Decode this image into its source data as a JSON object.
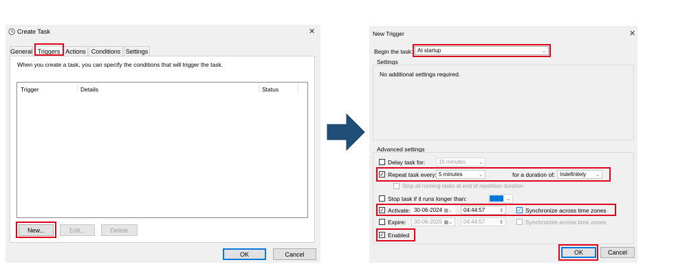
{
  "create_task": {
    "title": "Create Task",
    "tabs": [
      "General",
      "Triggers",
      "Actions",
      "Conditions",
      "Settings"
    ],
    "description": "When you create a task, you can specify the conditions that will trigger the task.",
    "columns": [
      "Trigger",
      "Details",
      "Status"
    ],
    "new_label": "New...",
    "edit_label": "Edit...",
    "delete_label": "Delete",
    "ok_label": "OK",
    "cancel_label": "Cancel",
    "close_glyph": "✕"
  },
  "new_trigger": {
    "title": "New Trigger",
    "close_glyph": "✕",
    "begin_label": "Begin the task:",
    "begin_value": "At startup",
    "settings_label": "Settings",
    "settings_text": "No additional settings required.",
    "advanced_label": "Advanced settings",
    "delay_label": "Delay task for:",
    "delay_value": "15 minutes",
    "repeat_label": "Repeat task every:",
    "repeat_value": "5 minutes",
    "duration_label": "for a duration of:",
    "duration_value": "Indefinitely",
    "stop_all_label": "Stop all running tasks at end of repetition duration",
    "stop_longer_label": "Stop task if it runs longer than:",
    "activate_label": "Activate:",
    "activate_date": "30-06-2024",
    "activate_time": "04:44:57",
    "sync_label": "Synchronize across time zones",
    "expire_label": "Expire:",
    "expire_date": "30-06-2025",
    "expire_time": "04:44:57",
    "enabled_label": "Enabled",
    "ok_label": "OK",
    "cancel_label": "Cancel",
    "checks": {
      "delay": false,
      "repeat": true,
      "stop_all": false,
      "stop_longer": false,
      "activate": true,
      "sync_activate": true,
      "expire": false,
      "sync_expire": false,
      "enabled": true
    },
    "check_glyph": "✓"
  },
  "colors": {
    "highlight": "#e0001a",
    "arrow": "#1f4e79",
    "dialog_bg": "#f0f0f0",
    "accent": "#0078d7"
  }
}
